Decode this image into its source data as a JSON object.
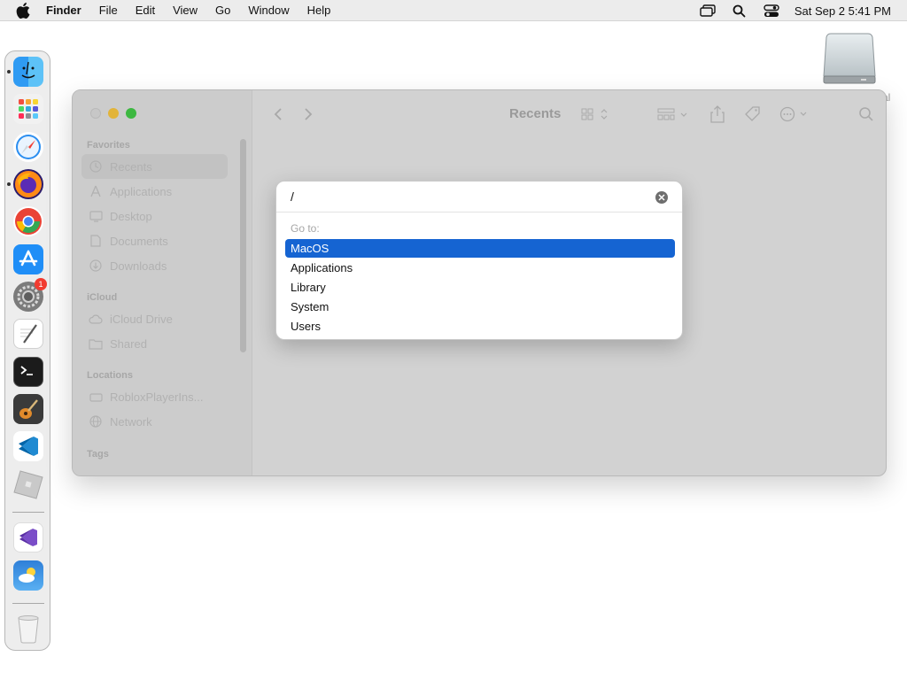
{
  "menubar": {
    "app_name": "Finder",
    "items": [
      "File",
      "Edit",
      "View",
      "Go",
      "Window",
      "Help"
    ],
    "clock": "Sat Sep 2  5:41 PM",
    "status_icons": [
      "screen-mirroring-icon",
      "spotlight-search-icon",
      "control-center-icon"
    ]
  },
  "desktop": {
    "drive_label": "al"
  },
  "dock": {
    "apps": [
      {
        "name": "finder",
        "running": true
      },
      {
        "name": "launchpad",
        "running": false
      },
      {
        "name": "safari",
        "running": false
      },
      {
        "name": "firefox",
        "running": true
      },
      {
        "name": "chrome",
        "running": false
      },
      {
        "name": "app-store",
        "running": false
      },
      {
        "name": "system-settings",
        "running": false,
        "badge": "1"
      },
      {
        "name": "textedit",
        "running": false
      },
      {
        "name": "terminal",
        "running": false
      },
      {
        "name": "garageband",
        "running": false
      },
      {
        "name": "vscode",
        "running": false
      },
      {
        "name": "roblox",
        "running": false
      },
      {
        "name": "visual-studio",
        "running": false
      },
      {
        "name": "weather",
        "running": false
      },
      {
        "name": "trash",
        "running": false
      }
    ]
  },
  "finder": {
    "title": "Recents",
    "sidebar": {
      "favorites_label": "Favorites",
      "favorites": [
        "Recents",
        "Applications",
        "Desktop",
        "Documents",
        "Downloads"
      ],
      "icloud_label": "iCloud",
      "icloud": [
        "iCloud Drive",
        "Shared"
      ],
      "locations_label": "Locations",
      "locations": [
        "RobloxPlayerIns...",
        "Network"
      ],
      "tags_label": "Tags"
    }
  },
  "goto_dialog": {
    "input_value": "/",
    "heading": "Go to:",
    "options": [
      "MacOS",
      "Applications",
      "Library",
      "System",
      "Users"
    ],
    "selected_index": 0
  },
  "colors": {
    "selection": "#1564d2",
    "close": "#ff5f57",
    "minimize": "#febc2e",
    "zoom": "#28c840"
  }
}
